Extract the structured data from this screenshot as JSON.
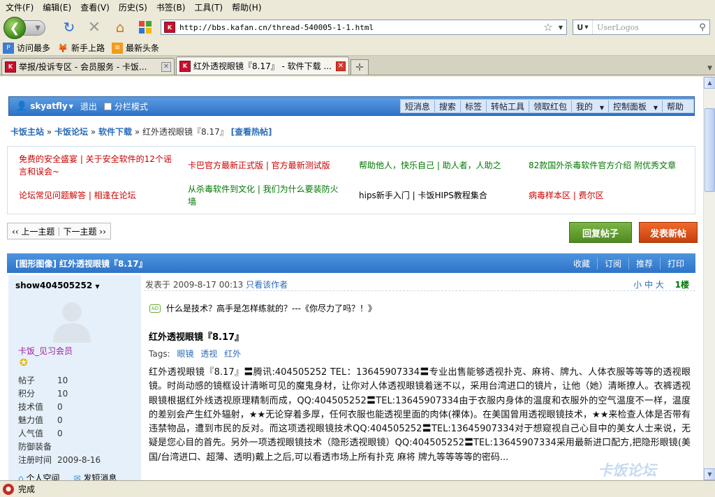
{
  "menu": {
    "items": [
      "文件(F)",
      "编辑(E)",
      "查看(V)",
      "历史(S)",
      "书签(B)",
      "工具(T)",
      "帮助(H)"
    ]
  },
  "nav": {
    "url": "http://bbs.kafan.cn/thread-540005-1-1.html",
    "search_placeholder": "UserLogos",
    "search_engine": "U"
  },
  "bookmarks": {
    "items": [
      "访问最多",
      "新手上路",
      "最新头条"
    ]
  },
  "tabs": [
    {
      "label": "举报/投诉专区 - 会员服务 - 卡饭...",
      "active": false
    },
    {
      "label": "红外透视眼镜『8.17』 - 软件下载 ...",
      "active": true
    }
  ],
  "forum": {
    "user": "skyatfly",
    "logout": "退出",
    "split_mode": "分栏模式",
    "toolbar": [
      "短消息",
      "搜索",
      "标签",
      "转帖工具",
      "领取红包",
      "我的",
      "控制面板",
      "帮助"
    ],
    "breadcrumb": {
      "home": "卡饭主站",
      "forum": "卡饭论坛",
      "board": "软件下载",
      "title": "红外透视眼镜『8.17』",
      "hot": "[查看热帖]"
    },
    "announcements": [
      "免费的安全盛宴 | 关于安全软件的12个谣言和误会~",
      "卡巴官方最新正式版 | 官方最新测试版",
      "帮助他人，快乐自己 | 助人者，人助之",
      "82款国外杀毒软件官方介绍 附优秀文章",
      "论坛常见问题解答 | 相逢在论坛",
      "从杀毒软件到文化 | 我们为什么要装防火墙",
      "hips新手入门 | 卡饭HIPS教程集合",
      "病毒样本区 | 费尔区"
    ],
    "pager": {
      "prev": "‹‹ 上一主题",
      "next": "下一主题 ››"
    },
    "reply_button": "回复帖子",
    "new_button": "发表新帖",
    "thread": {
      "category": "[图形图像]",
      "title": "红外透视眼镜『8.17』",
      "actions": [
        "收藏",
        "订阅",
        "推荐",
        "打印"
      ]
    },
    "post": {
      "author": "show404505252",
      "rank": "卡饭_见习会员",
      "stats": [
        {
          "k": "帖子",
          "v": "10"
        },
        {
          "k": "积分",
          "v": "10"
        },
        {
          "k": "技术值",
          "v": "0"
        },
        {
          "k": "魅力值",
          "v": "0"
        },
        {
          "k": "人气值",
          "v": "0"
        },
        {
          "k": "防御装备",
          "v": ""
        },
        {
          "k": "注册时间",
          "v": "2009-8-16"
        }
      ],
      "links": [
        "个人空间",
        "发短消息"
      ],
      "meta": "发表于 2009-8-17 00:13",
      "only_author": "只看该作者",
      "size_links": "小 中 大",
      "floor": "1楼",
      "ad_text": "什么是技术？高手是怎样练就的？---《你尽力了吗？！》",
      "ad_label": "AD",
      "title": "红外透视眼镜『8.17』",
      "tags_label": "Tags:",
      "tags": [
        "眼镜",
        "透视",
        "红外"
      ],
      "body": "红外透视眼镜『8.17』〓腾讯:404505252 TEL：13645907334〓专业出售能够透视扑克、麻将、牌九、人体衣服等等等的透视眼镜。时尚动感的镜框设计清晰可见的魔鬼身材，让你对人体透视眼镜着迷不以，采用台湾进口的镜片，让他（她）清晰撩人。衣裤透视眼镜根据红外线透视原理精制而成，QQ:404505252〓TEL:13645907334由于衣服内身体的温度和衣服外的空气温度不一样，温度的差别会产生红外辐射，★★无论穿着多厚，任何衣服也能透视里面的肉体(裸体)。在美国曾用透视眼镜技术，★★来检查人体是否带有违禁物品，遭到市民的反对。而这项透视眼镜技术QQ:404505252〓TEL:13645907334对于想窥视自己心目中的美女人士来说，无疑是您心目的首先。另外一项透视眼镜技术（隐形透视眼镜）QQ:404505252〓TEL:13645907334采用最新进口配方,把隐形眼镜(美国/台湾进口、超薄、透明)戴上之后,可以看透市场上所有扑克 麻将 牌九等等等等的密码..."
    }
  },
  "watermark": "卡饭论坛",
  "status": {
    "text": "完成"
  }
}
